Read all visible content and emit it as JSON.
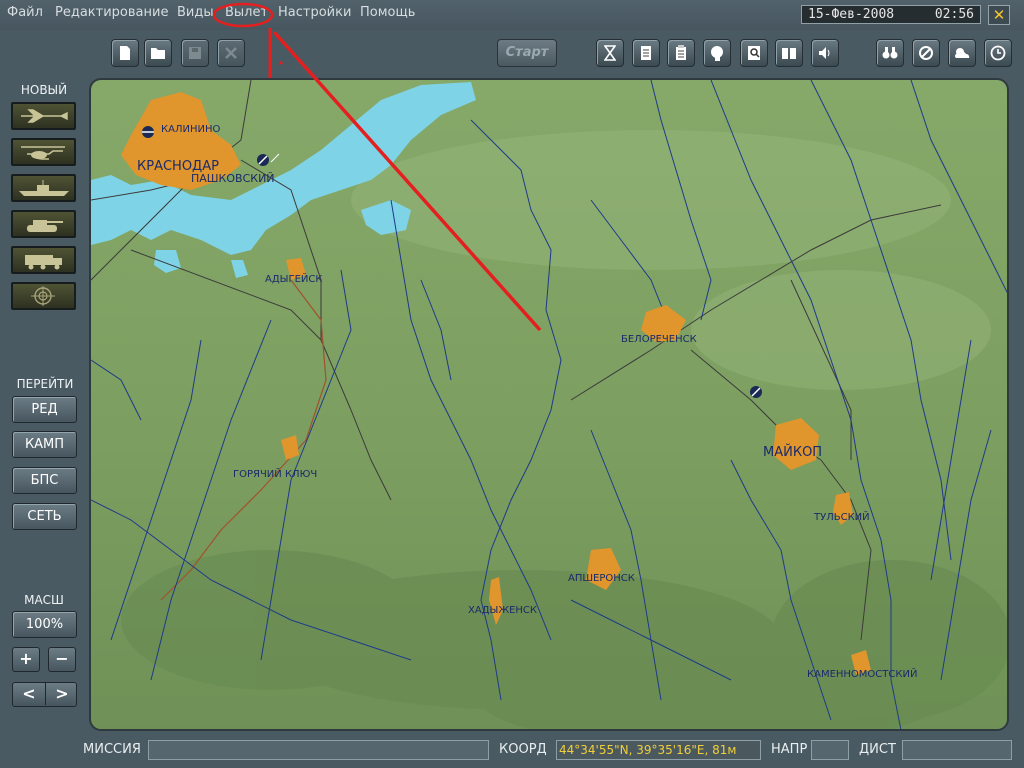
{
  "menu": {
    "items": [
      "Файл",
      "Редактирование",
      "Виды",
      "Вылет",
      "Настройки",
      "Помощь"
    ]
  },
  "clock": {
    "date": "15-Фев-2008",
    "time": "02:56"
  },
  "close_symbol": "✕",
  "toolbar": {
    "start_label": "Старт",
    "left_icons": [
      "new-document-icon",
      "open-folder-icon",
      "save-icon",
      "delete-icon"
    ],
    "right_icons": [
      "hourglass-icon",
      "briefing-icon",
      "list-icon",
      "head-icon",
      "magnifier-icon",
      "book-icon",
      "speaker-icon",
      "binoculars-icon",
      "forbidden-icon",
      "weather-icon",
      "clock-icon"
    ]
  },
  "sidebar": {
    "new_heading": "НОВЫЙ",
    "new_units": [
      "aircraft-icon",
      "helicopter-icon",
      "ship-icon",
      "tank-icon",
      "truck-icon",
      "target-icon"
    ],
    "goto_heading": "ПЕРЕЙТИ",
    "goto_buttons": [
      "РЕД",
      "КАМП",
      "БПС",
      "СЕТЬ"
    ],
    "scale_heading": "МАСШ",
    "scale_value": "100%",
    "zoom_in": "+",
    "zoom_out": "−",
    "prev": "<",
    "next": ">"
  },
  "map": {
    "cities": {
      "kalinino": "КАЛИНИНО",
      "krasnodar": "КРАСНОДАР",
      "pashkovsky": "ПАШКОВСКИЙ",
      "adygeysk": "АДЫГЕЙСК",
      "belorechensk": "БЕЛОРЕЧЕНСК",
      "maykop": "МАЙКОП",
      "tulsky": "ТУЛЬСКИЙ",
      "goryachy_klyuch": "ГОРЯЧИЙ КЛЮЧ",
      "apsheronsk": "АПШЕРОНСК",
      "khadyzhensk": "ХАДЫЖЕНСК",
      "kamennomostsky": "КАМЕННОМОСТСКИЙ"
    },
    "colors": {
      "terrain": "#7ea062",
      "water": "#7fd3e6",
      "city": "#e0962c",
      "annotation": "#e41f1f"
    }
  },
  "status": {
    "mission_label": "МИССИЯ",
    "coord_label": "КООРД",
    "coord_value": "44°34'55\"N, 39°35'16\"E, 81м",
    "heading_label": "НАПР",
    "distance_label": "ДИСТ"
  }
}
